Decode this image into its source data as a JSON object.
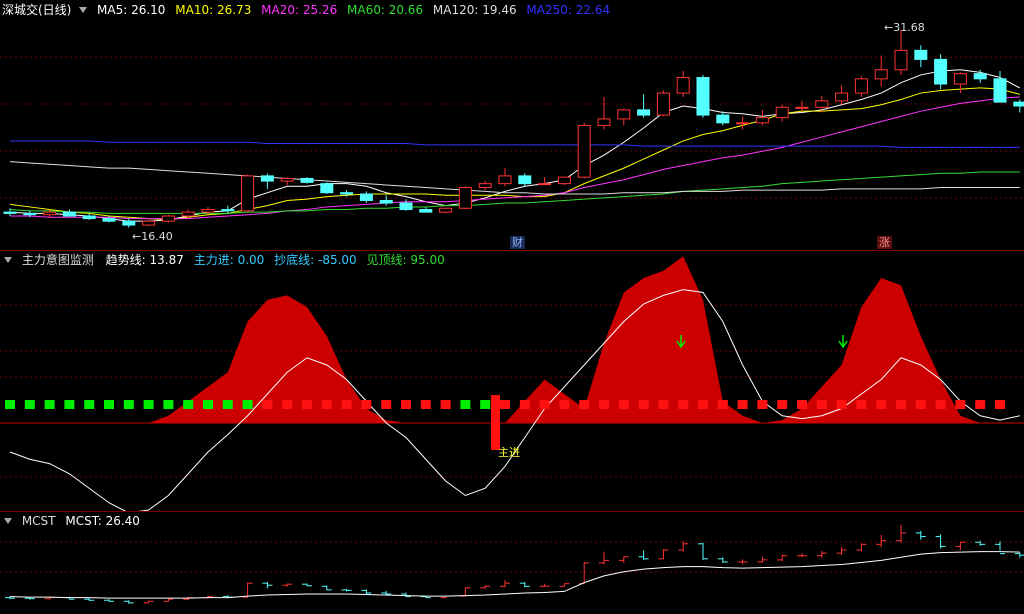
{
  "main": {
    "title": "深城交(日线)",
    "ma": [
      {
        "label": "MA5: 26.10",
        "color": "#ffffff"
      },
      {
        "label": "MA10: 26.73",
        "color": "#ffff00"
      },
      {
        "label": "MA20: 25.26",
        "color": "#ff33ff"
      },
      {
        "label": "MA60: 20.66",
        "color": "#33dd33"
      },
      {
        "label": "MA120: 19.46",
        "color": "#dddddd"
      },
      {
        "label": "MA250: 22.64",
        "color": "#3333ff"
      }
    ],
    "high_label": "31.68",
    "low_label": "16.40",
    "badge_cai": "财",
    "badge_zhang": "涨"
  },
  "indicator": {
    "title": "主力意图监测",
    "items": [
      {
        "label": "趋势线: 13.87",
        "color": "#ffffff"
      },
      {
        "label": "主力进: 0.00",
        "color": "#33ccff"
      },
      {
        "label": "抄底线: -85.00",
        "color": "#33ccff"
      },
      {
        "label": "见顶线: 95.00",
        "color": "#33dd33"
      }
    ],
    "signal_text": "主进"
  },
  "mcst": {
    "title": "MCST",
    "value_label": "MCST: 26.40"
  },
  "colors": {
    "up": "#ff3333",
    "down": "#54ffff",
    "fill": "#cc0000",
    "green": "#00ee00"
  },
  "candles": [
    [
      17.6,
      17.9,
      17.3,
      17.5
    ],
    [
      17.5,
      17.7,
      17.2,
      17.4
    ],
    [
      17.4,
      17.8,
      17.2,
      17.6
    ],
    [
      17.6,
      17.8,
      17.3,
      17.3
    ],
    [
      17.3,
      17.5,
      17.0,
      17.1
    ],
    [
      17.1,
      17.3,
      16.8,
      16.9
    ],
    [
      16.9,
      17.1,
      16.4,
      16.6
    ],
    [
      16.6,
      17.0,
      16.5,
      16.9
    ],
    [
      16.9,
      17.4,
      16.8,
      17.3
    ],
    [
      17.3,
      17.8,
      17.1,
      17.6
    ],
    [
      17.6,
      18.0,
      17.4,
      17.8
    ],
    [
      17.8,
      18.1,
      17.5,
      17.7
    ],
    [
      17.7,
      20.5,
      17.6,
      20.4
    ],
    [
      20.4,
      20.6,
      19.4,
      20.0
    ],
    [
      20.0,
      20.3,
      19.7,
      20.2
    ],
    [
      20.2,
      20.3,
      19.8,
      19.9
    ],
    [
      19.8,
      19.9,
      19.0,
      19.1
    ],
    [
      19.1,
      19.3,
      18.8,
      19.0
    ],
    [
      19.0,
      19.2,
      18.3,
      18.5
    ],
    [
      18.5,
      18.9,
      18.1,
      18.3
    ],
    [
      18.3,
      18.6,
      17.7,
      17.8
    ],
    [
      17.8,
      18.0,
      17.6,
      17.6
    ],
    [
      17.6,
      17.9,
      17.5,
      17.9
    ],
    [
      17.9,
      19.6,
      17.8,
      19.5
    ],
    [
      19.5,
      20.0,
      19.3,
      19.8
    ],
    [
      19.8,
      21.0,
      19.6,
      20.4
    ],
    [
      20.4,
      20.6,
      19.6,
      19.8
    ],
    [
      19.8,
      20.3,
      19.7,
      19.8
    ],
    [
      19.8,
      20.3,
      19.7,
      20.3
    ],
    [
      20.3,
      24.5,
      20.2,
      24.3
    ],
    [
      24.3,
      26.5,
      24.0,
      24.8
    ],
    [
      24.8,
      25.6,
      24.3,
      25.5
    ],
    [
      25.5,
      26.7,
      24.9,
      25.1
    ],
    [
      25.1,
      27.0,
      25.0,
      26.8
    ],
    [
      26.8,
      28.5,
      26.5,
      28.0
    ],
    [
      28.0,
      28.2,
      24.9,
      25.1
    ],
    [
      25.1,
      25.4,
      24.3,
      24.5
    ],
    [
      24.5,
      25.0,
      24.0,
      24.5
    ],
    [
      24.5,
      25.5,
      24.3,
      24.9
    ],
    [
      24.9,
      25.9,
      24.6,
      25.7
    ],
    [
      25.7,
      26.2,
      25.4,
      25.7
    ],
    [
      25.7,
      26.6,
      25.3,
      26.2
    ],
    [
      26.2,
      27.4,
      25.9,
      26.8
    ],
    [
      26.8,
      28.1,
      26.5,
      27.9
    ],
    [
      27.9,
      29.7,
      27.3,
      28.6
    ],
    [
      28.6,
      31.68,
      28.2,
      30.1
    ],
    [
      30.1,
      30.5,
      28.8,
      29.4
    ],
    [
      29.4,
      29.8,
      27.1,
      27.5
    ],
    [
      27.5,
      28.4,
      26.8,
      28.3
    ],
    [
      28.3,
      28.6,
      27.6,
      27.9
    ],
    [
      27.9,
      28.5,
      26.7,
      26.1
    ],
    [
      26.1,
      26.3,
      25.3,
      25.8
    ]
  ],
  "ma_series": {
    "ma5": [
      17.6,
      17.5,
      17.5,
      17.4,
      17.3,
      17.1,
      16.9,
      16.9,
      17.0,
      17.3,
      17.6,
      17.7,
      18.6,
      19.1,
      19.6,
      19.6,
      19.8,
      19.8,
      19.6,
      19.1,
      18.8,
      18.4,
      18.1,
      18.3,
      18.7,
      19.2,
      19.6,
      19.8,
      20.1,
      21.2,
      22.0,
      23.0,
      24.1,
      25.3,
      25.8,
      25.6,
      25.3,
      25.2,
      25.0,
      25.2,
      25.3,
      25.5,
      25.9,
      26.3,
      26.8,
      27.6,
      28.2,
      28.5,
      28.6,
      28.4,
      28.0,
      27.2
    ],
    "ma10": [
      18.2,
      18.0,
      17.8,
      17.6,
      17.5,
      17.3,
      17.2,
      17.1,
      17.0,
      17.2,
      17.4,
      17.5,
      17.8,
      18.1,
      18.5,
      18.6,
      18.8,
      18.9,
      19.0,
      19.0,
      19.0,
      19.0,
      18.9,
      18.9,
      18.9,
      18.9,
      18.8,
      18.8,
      19.1,
      19.8,
      20.4,
      21.0,
      21.7,
      22.4,
      23.1,
      23.6,
      23.9,
      24.3,
      24.7,
      25.2,
      25.4,
      25.4,
      25.5,
      25.6,
      25.9,
      26.3,
      26.8,
      27.0,
      27.1,
      27.2,
      27.1,
      26.7
    ],
    "ma20": [
      17.3,
      17.3,
      17.2,
      17.2,
      17.2,
      17.2,
      17.1,
      17.1,
      17.1,
      17.1,
      17.2,
      17.3,
      17.4,
      17.5,
      17.7,
      17.8,
      18.0,
      18.1,
      18.2,
      18.3,
      18.4,
      18.4,
      18.4,
      18.5,
      18.6,
      18.7,
      18.8,
      18.9,
      19.1,
      19.5,
      19.8,
      20.1,
      20.5,
      20.9,
      21.2,
      21.5,
      21.8,
      22.0,
      22.3,
      22.6,
      23.0,
      23.4,
      23.8,
      24.2,
      24.6,
      25.0,
      25.4,
      25.7,
      26.0,
      26.2,
      26.4,
      26.5
    ],
    "ma60": [
      17.8,
      17.7,
      17.7,
      17.6,
      17.6,
      17.5,
      17.5,
      17.5,
      17.5,
      17.5,
      17.5,
      17.5,
      17.6,
      17.6,
      17.7,
      17.7,
      17.8,
      17.8,
      17.9,
      17.9,
      18.0,
      18.0,
      18.1,
      18.1,
      18.2,
      18.3,
      18.3,
      18.4,
      18.5,
      18.6,
      18.7,
      18.8,
      18.9,
      19.0,
      19.2,
      19.3,
      19.4,
      19.5,
      19.6,
      19.8,
      19.9,
      20.0,
      20.1,
      20.2,
      20.3,
      20.4,
      20.5,
      20.6,
      20.6,
      20.7,
      20.7,
      20.7
    ],
    "ma120": [
      21.5,
      21.4,
      21.3,
      21.2,
      21.1,
      21.0,
      21.0,
      20.9,
      20.8,
      20.7,
      20.6,
      20.5,
      20.4,
      20.3,
      20.2,
      20.1,
      20.0,
      19.9,
      19.8,
      19.7,
      19.6,
      19.5,
      19.4,
      19.3,
      19.2,
      19.1,
      19.1,
      19.0,
      19.0,
      19.0,
      19.0,
      19.1,
      19.1,
      19.1,
      19.2,
      19.2,
      19.2,
      19.3,
      19.3,
      19.3,
      19.3,
      19.3,
      19.4,
      19.4,
      19.4,
      19.4,
      19.4,
      19.5,
      19.5,
      19.5,
      19.5,
      19.5
    ],
    "ma250": [
      23.1,
      23.1,
      23.1,
      23.1,
      23.1,
      23.0,
      23.0,
      23.0,
      23.0,
      23.0,
      23.0,
      23.0,
      23.0,
      22.9,
      22.9,
      22.9,
      22.9,
      22.9,
      22.9,
      22.9,
      22.9,
      22.8,
      22.8,
      22.8,
      22.8,
      22.8,
      22.8,
      22.8,
      22.8,
      22.8,
      22.8,
      22.8,
      22.7,
      22.7,
      22.7,
      22.7,
      22.7,
      22.7,
      22.7,
      22.7,
      22.7,
      22.7,
      22.7,
      22.7,
      22.7,
      22.6,
      22.6,
      22.6,
      22.6,
      22.6,
      22.6,
      22.6
    ]
  },
  "indicator_series": {
    "trend": [
      -20,
      -25,
      -28,
      -35,
      -45,
      -55,
      -62,
      -60,
      -50,
      -35,
      -20,
      -8,
      5,
      20,
      35,
      45,
      40,
      30,
      15,
      0,
      -10,
      -25,
      -40,
      -50,
      -45,
      -30,
      -10,
      10,
      25,
      40,
      55,
      70,
      82,
      88,
      92,
      90,
      70,
      40,
      15,
      5,
      3,
      5,
      10,
      20,
      30,
      45,
      40,
      30,
      15,
      5,
      2,
      5
    ],
    "area": [
      0,
      0,
      0,
      0,
      0,
      0,
      0,
      0,
      5,
      15,
      25,
      35,
      70,
      85,
      88,
      80,
      60,
      30,
      10,
      2,
      0,
      0,
      0,
      0,
      0,
      0,
      15,
      30,
      20,
      10,
      55,
      90,
      100,
      105,
      115,
      85,
      15,
      5,
      0,
      2,
      10,
      25,
      40,
      80,
      100,
      95,
      60,
      30,
      5,
      0,
      0,
      0
    ],
    "squares": [
      "g",
      "g",
      "g",
      "g",
      "g",
      "g",
      "g",
      "g",
      "g",
      "g",
      "g",
      "g",
      "g",
      "r",
      "r",
      "r",
      "r",
      "r",
      "r",
      "r",
      "r",
      "r",
      "r",
      "g",
      "g",
      "r",
      "r",
      "r",
      "r",
      "r",
      "r",
      "r",
      "r",
      "r",
      "r",
      "r",
      "r",
      "r",
      "r",
      "r",
      "r",
      "r",
      "r",
      "r",
      "r",
      "r",
      "r",
      "r",
      "r",
      "r",
      "r"
    ]
  },
  "mcst_series": [
    17.8,
    17.7,
    17.7,
    17.6,
    17.6,
    17.5,
    17.5,
    17.5,
    17.5,
    17.5,
    17.6,
    17.6,
    17.9,
    18.1,
    18.2,
    18.3,
    18.3,
    18.3,
    18.2,
    18.1,
    18.0,
    17.9,
    17.9,
    18.0,
    18.1,
    18.3,
    18.5,
    18.6,
    18.8,
    20.5,
    21.8,
    22.6,
    23.1,
    23.4,
    23.6,
    23.6,
    23.4,
    23.3,
    23.4,
    23.5,
    23.6,
    23.8,
    24.0,
    24.4,
    24.8,
    25.4,
    26.0,
    26.3,
    26.4,
    26.5,
    26.5,
    26.4
  ]
}
